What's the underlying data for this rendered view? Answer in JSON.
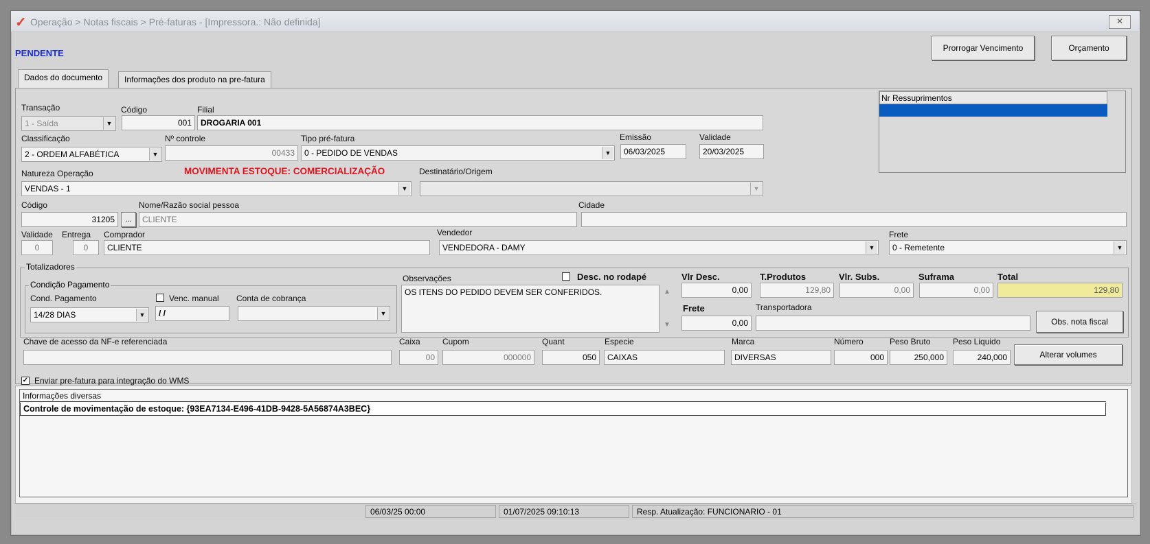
{
  "window": {
    "title": "Operação > Notas fiscais > Pré-faturas - [Impressora.: Não definida]",
    "close_glyph": "✕"
  },
  "status_label": "PENDENTE",
  "buttons": {
    "prorrogar": "Prorrogar Vencimento",
    "orcamento": "Orçamento",
    "obs_nota": "Obs. nota fiscal",
    "alterar_volumes": "Alterar volumes",
    "ellipsis": "..."
  },
  "tabs": [
    {
      "label": "Dados do documento"
    },
    {
      "label": "Informações dos produto na pre-fatura"
    }
  ],
  "ressuprimentos": {
    "header": "Nr Ressuprimentos"
  },
  "form": {
    "transacao": {
      "label": "Transação",
      "value": "1 - Saída"
    },
    "codigo": {
      "label": "Código",
      "value": "001"
    },
    "filial": {
      "label": "Filial",
      "value": "DROGARIA 001"
    },
    "classificacao": {
      "label": "Classificação",
      "value": "2 - ORDEM ALFABÉTICA"
    },
    "nr_controle": {
      "label": "Nº controle",
      "value": "00433"
    },
    "tipo_prefatura": {
      "label": "Tipo pré-fatura",
      "value": "0 - PEDIDO DE VENDAS"
    },
    "emissao": {
      "label": "Emissão",
      "value": "06/03/2025"
    },
    "validade": {
      "label": "Validade",
      "value": "20/03/2025"
    },
    "natureza": {
      "label": "Natureza  Operação",
      "value": "VENDAS - 1"
    },
    "movimenta_estoque": "MOVIMENTA ESTOQUE: COMERCIALIZAÇÃO",
    "destinatario": {
      "label": "Destinatário/Origem",
      "value": ""
    },
    "pessoa_codigo": {
      "label": "Código",
      "value": "31205"
    },
    "nome": {
      "label": "Nome/Razão social pessoa",
      "value": "CLIENTE"
    },
    "cidade": {
      "label": "Cidade",
      "value": ""
    },
    "validade_dias": {
      "label": "Validade",
      "value": "0"
    },
    "entrega": {
      "label": "Entrega",
      "value": "0"
    },
    "comprador": {
      "label": "Comprador",
      "value": "CLIENTE"
    },
    "vendedor": {
      "label": "Vendedor",
      "value": "VENDEDORA - DAMY"
    },
    "frete_tipo": {
      "label": "Frete",
      "value": "0 - Remetente"
    }
  },
  "totalizadores": {
    "label": "Totalizadores",
    "condicao_label": "Condição Pagamento",
    "cond_pagamento": {
      "label": "Cond. Pagamento",
      "value": "14/28 DIAS"
    },
    "venc_manual": {
      "label": "Venc. manual",
      "value": " /  / "
    },
    "conta_cobranca": {
      "label": "Conta de cobrança",
      "value": ""
    },
    "observacoes": {
      "label": "Observações",
      "value": "OS ITENS DO PEDIDO DEVEM SER CONFERIDOS."
    },
    "desc_rodape": "Desc. no rodapé",
    "vlr_desc": {
      "label": "Vlr Desc.",
      "value": "0,00"
    },
    "t_produtos": {
      "label": "T.Produtos",
      "value": "129,80"
    },
    "vlr_subs": {
      "label": "Vlr. Subs.",
      "value": "0,00"
    },
    "suframa": {
      "label": "Suframa",
      "value": "0,00"
    },
    "total": {
      "label": "Total",
      "value": "129,80"
    },
    "frete": {
      "label": "Frete",
      "value": "0,00"
    },
    "transportadora": {
      "label": "Transportadora",
      "value": ""
    }
  },
  "volumes": {
    "chave": {
      "label": "Chave de acesso da NF-e referenciada",
      "value": ""
    },
    "caixa": {
      "label": "Caixa",
      "value": "00"
    },
    "cupom": {
      "label": "Cupom",
      "value": "000000"
    },
    "quant": {
      "label": "Quant",
      "value": "050"
    },
    "especie": {
      "label": "Especie",
      "value": "CAIXAS"
    },
    "marca": {
      "label": "Marca",
      "value": "DIVERSAS"
    },
    "numero": {
      "label": "Número",
      "value": "000"
    },
    "peso_bruto": {
      "label": "Peso Bruto",
      "value": "250,000"
    },
    "peso_liquido": {
      "label": "Peso Liquido",
      "value": "240,000"
    }
  },
  "wms": {
    "label": "Enviar pre-fatura para integração do WMS",
    "checked": true
  },
  "info": {
    "header": "Informações diversas",
    "line": "Controle de movimentação de estoque: {93EA7134-E496-41DB-9428-5A56874A3BEC}"
  },
  "statusbar": {
    "date1": "06/03/25 00:00",
    "date2": "01/07/2025 09:10:13",
    "resp": "Resp. Atualização: FUNCIONARIO - 01"
  },
  "colors": {
    "status_blue": "#1a2bd0",
    "warning_red": "#e0141e",
    "total_yellow": "#efeb9a",
    "selected_row": "#0a5bbf"
  }
}
